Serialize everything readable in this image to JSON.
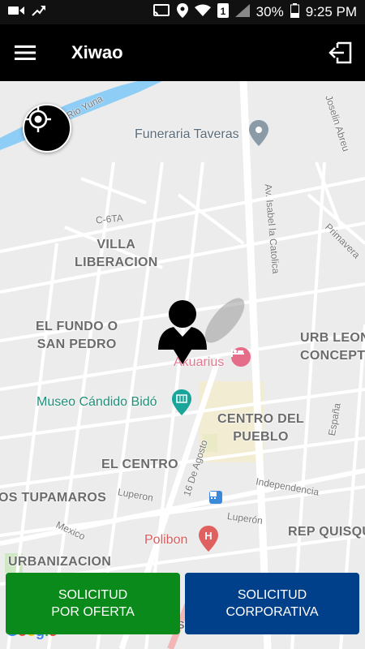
{
  "status_bar": {
    "battery": "30%",
    "time": "9:25 PM",
    "sim": "1"
  },
  "app_bar": {
    "title": "Xiwao"
  },
  "map": {
    "areas": [
      "VILLA\nLIBERACION",
      "EL FUNDO O\nSAN PEDRO",
      "URB LEON\nCONCEPT",
      "CENTRO DEL\nPUEBLO",
      "EL CENTRO",
      "OS TUPAMAROS",
      "REP QUISQU",
      "URBANIZACION"
    ],
    "pois": [
      "Funeraria Taveras",
      "Akuarius",
      "Museo Cándido Bidó",
      "Polibon"
    ],
    "streets": [
      "Rio Yuna",
      "Joselin Abreu",
      "C-6TA",
      "Av. Isabel la Catolica",
      "Primavera",
      "España",
      "16 De Agosto",
      "Independencia",
      "Luperon",
      "Luperón",
      "Mexico",
      "DO PROSPERIDAD"
    ]
  },
  "buttons": {
    "offer_line1": "SOLICITUD",
    "offer_line2": "POR OFERTA",
    "corp_line1": "SOLICITUD",
    "corp_line2": "CORPORATIVA"
  },
  "colors": {
    "app_bar": "#000000",
    "offer_button": "#0a8a1b",
    "corporate_button": "#003f8a"
  },
  "icons": [
    "menu-icon",
    "logout-icon",
    "locate-icon",
    "user-pin-icon",
    "place-pin-icon",
    "hotel-icon",
    "museum-icon",
    "hospital-icon",
    "bus-icon"
  ]
}
